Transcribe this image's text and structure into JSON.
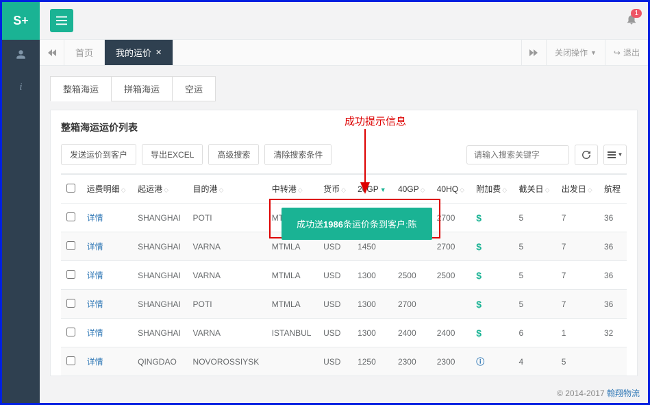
{
  "sidebar": {
    "logo": "S+"
  },
  "topbar": {
    "notif_count": "1"
  },
  "tabbar": {
    "home": "首页",
    "active": "我的运价",
    "close_ops": "关闭操作",
    "logout": "退出"
  },
  "subtabs": [
    "整箱海运",
    "拼箱海运",
    "空运"
  ],
  "panel": {
    "title": "整箱海运运价列表",
    "buttons": {
      "send": "发送运价到客户",
      "export": "导出EXCEL",
      "advanced": "高级搜索",
      "clear": "清除搜索条件"
    },
    "search_placeholder": "请输入搜索关键字"
  },
  "columns": {
    "detail": "运费明细",
    "origin": "起运港",
    "dest": "目的港",
    "transit": "中转港",
    "currency": "货币",
    "c20gp": "20GP",
    "c40gp": "40GP",
    "c40hq": "40HQ",
    "surcharge": "附加费",
    "cutoff": "截关日",
    "depart": "出发日",
    "voyage": "航程"
  },
  "detail_label": "详情",
  "rows": [
    {
      "origin": "SHANGHAI",
      "dest": "POTI",
      "transit": "MTM",
      "currency": "",
      "c20gp": "",
      "c40gp": "",
      "c40hq": "2700",
      "sur": "$",
      "cutoff": "5",
      "depart": "7",
      "voyage": "36"
    },
    {
      "origin": "SHANGHAI",
      "dest": "VARNA",
      "transit": "MTMLA",
      "currency": "USD",
      "c20gp": "1450",
      "c40gp": "",
      "c40hq": "2700",
      "sur": "$",
      "cutoff": "5",
      "depart": "7",
      "voyage": "36"
    },
    {
      "origin": "SHANGHAI",
      "dest": "VARNA",
      "transit": "MTMLA",
      "currency": "USD",
      "c20gp": "1300",
      "c40gp": "2500",
      "c40hq": "2500",
      "sur": "$",
      "cutoff": "5",
      "depart": "7",
      "voyage": "36"
    },
    {
      "origin": "SHANGHAI",
      "dest": "POTI",
      "transit": "MTMLA",
      "currency": "USD",
      "c20gp": "1300",
      "c40gp": "2700",
      "c40hq": "",
      "sur": "$",
      "cutoff": "5",
      "depart": "7",
      "voyage": "36"
    },
    {
      "origin": "SHANGHAI",
      "dest": "VARNA",
      "transit": "ISTANBUL",
      "currency": "USD",
      "c20gp": "1300",
      "c40gp": "2400",
      "c40hq": "2400",
      "sur": "$",
      "cutoff": "6",
      "depart": "1",
      "voyage": "32"
    },
    {
      "origin": "QINGDAO",
      "dest": "NOVOROSSIYSK",
      "transit": "",
      "currency": "USD",
      "c20gp": "1250",
      "c40gp": "2300",
      "c40hq": "2300",
      "sur": "i",
      "cutoff": "4",
      "depart": "5",
      "voyage": ""
    }
  ],
  "annotation": {
    "label": "成功提示信息"
  },
  "toast": {
    "prefix": "成功送",
    "count": "1986",
    "suffix": "条运价条到客户:陈"
  },
  "footer": {
    "copyright": "© 2014-2017 ",
    "company": "翰翔物流"
  }
}
